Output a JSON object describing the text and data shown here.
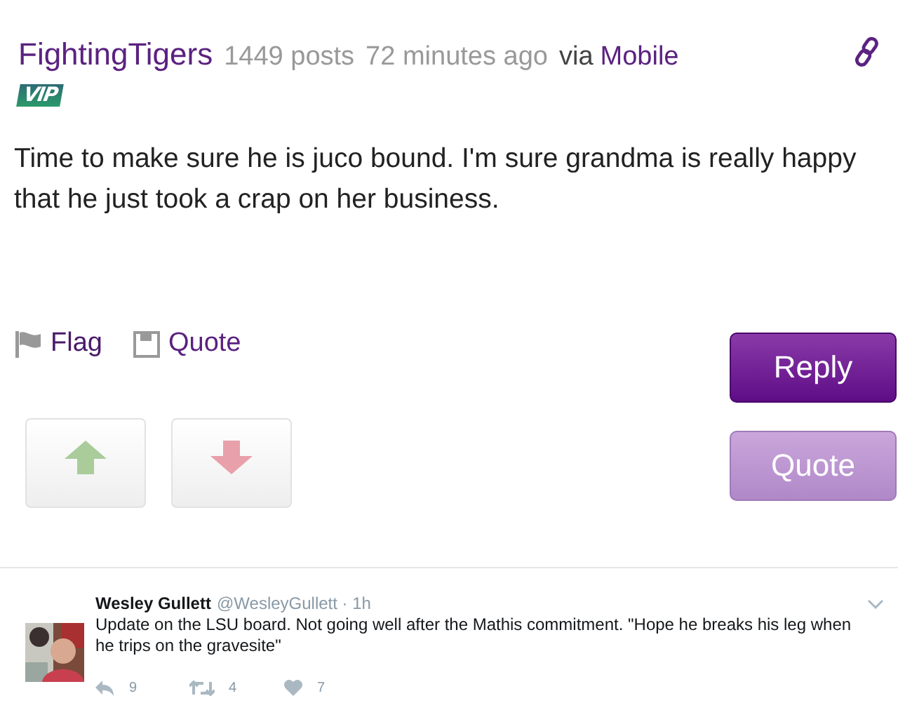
{
  "post": {
    "author": "FightingTigers",
    "posts": "1449 posts",
    "time": "72 minutes ago",
    "via": "via",
    "source": "Mobile",
    "badge": "VIP",
    "body": "Time to make sure he is juco bound. I'm sure grandma is really happy that he just took a crap on her business.",
    "actions": [
      {
        "kind": "flag",
        "label": "Flag"
      },
      {
        "kind": "quote",
        "label": "Quote"
      }
    ],
    "votes": [
      {
        "kind": "up"
      },
      {
        "kind": "down"
      }
    ],
    "buttons": [
      {
        "kind": "primary",
        "label": "Reply"
      },
      {
        "kind": "secondary",
        "label": "Quote"
      }
    ]
  },
  "tweet": {
    "name": "Wesley Gullett",
    "meta": "@WesleyGullett · 1h",
    "text": "Update on the LSU board. Not going well after the Mathis commitment. \"Hope he breaks his leg when he trips on the gravesite\"",
    "stats": [
      {
        "kind": "reply",
        "count": "9"
      },
      {
        "kind": "retweet",
        "count": "4"
      },
      {
        "kind": "like",
        "count": "7"
      }
    ]
  }
}
